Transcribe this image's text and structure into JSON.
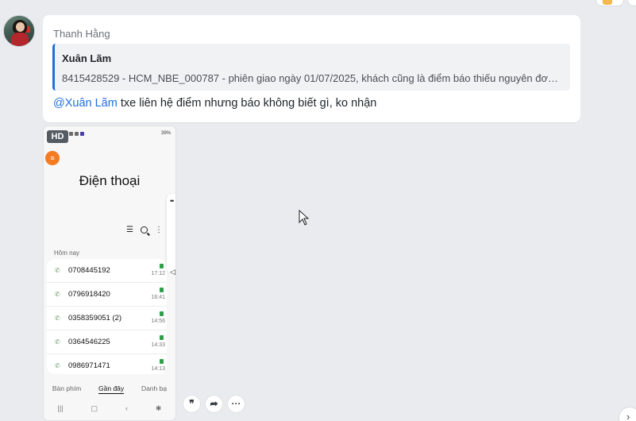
{
  "message": {
    "sender_name": "Thanh Hằng",
    "quote": {
      "author": "Xuân Lãm",
      "text": "8415428529 - HCM_NBE_000787 - phiên giao ngày 01/07/2025, khách cũng là điểm báo thiếu nguyên đơn, ..."
    },
    "mention": "@Xuân Lãm",
    "text": " txe liên hệ điểm nhưng báo không biết gì, ko nhận"
  },
  "attachment": {
    "badge": "HD",
    "phone": {
      "status_battery": "39%",
      "title": "Điện thoại",
      "section_label": "Hôm nay",
      "calls": [
        {
          "number": "0708445192",
          "time": "17:12"
        },
        {
          "number": "0796918420",
          "time": "16:41"
        },
        {
          "number": "0358359051 (2)",
          "time": "14:56"
        },
        {
          "number": "0364546225",
          "time": "14:33"
        },
        {
          "number": "0986971471",
          "time": "14:13"
        }
      ],
      "tabs": [
        "Bàn phím",
        "Gần đây",
        "Danh bạ"
      ],
      "active_tab": "Gần đây",
      "accent_color": "#f47b20"
    }
  },
  "actions": {
    "quote_icon": "quote-icon",
    "forward_icon": "forward-icon",
    "more_icon": "more-icon"
  },
  "colors": {
    "mention": "#1f6fe0",
    "background": "#e9ebef"
  }
}
